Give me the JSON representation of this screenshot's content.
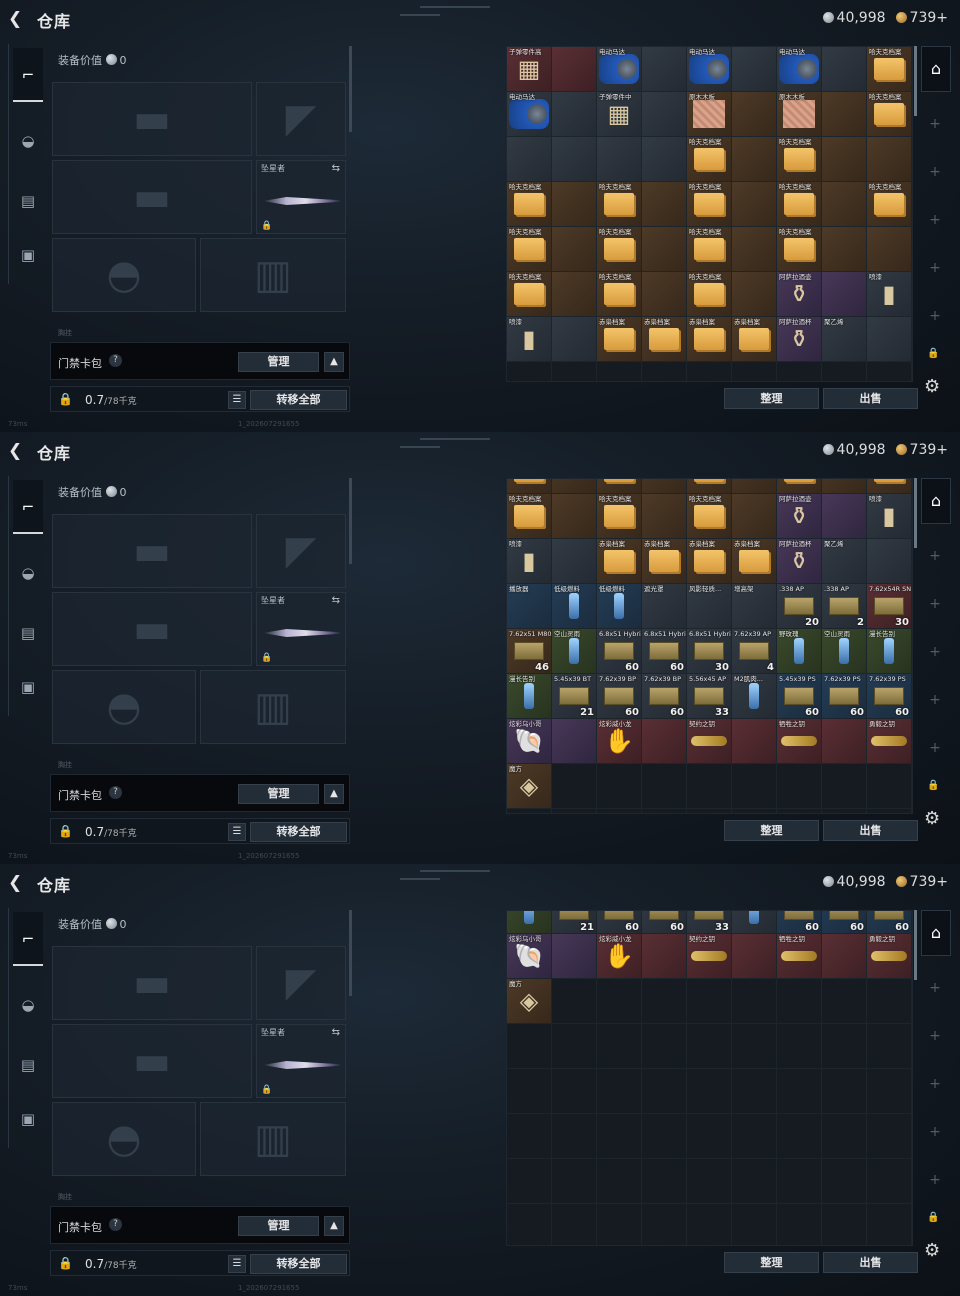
{
  "header": {
    "title": "仓库",
    "silver": "40,998",
    "gold": "739+"
  },
  "loadout": {
    "equip_value_label": "装备价值",
    "equip_value": "0",
    "melee_label": "坠星者",
    "faint_label": "胸挂",
    "access_card_label": "门禁卡包",
    "manage_label": "管理",
    "weight_value": "0.7",
    "weight_cap": "/78千克",
    "transfer_all_label": "转移全部"
  },
  "stash_buttons": {
    "sort_label": "整理",
    "sell_label": "出售"
  },
  "footer": {
    "ping": "73ms",
    "uid": "1_202607291655"
  },
  "colors": {
    "accent": "#d8d8d8",
    "rare_purple": "#483857",
    "rare_red": "#5a2f34",
    "gold_coin": "#d79b3d"
  },
  "nav_icons": [
    "gun-icon",
    "helmet-icon",
    "vest-icon",
    "briefcase-icon"
  ],
  "stash_views": [
    {
      "cells": [
        {
          "n": "子弹零件高",
          "r": "r-red",
          "p": "parts"
        },
        {
          "n": "",
          "r": "r-red",
          "p": "none"
        },
        {
          "n": "电动马达",
          "r": "r-gray",
          "p": "motor"
        },
        {
          "n": "",
          "r": "r-gray",
          "p": "none"
        },
        {
          "n": "电动马达",
          "r": "r-gray",
          "p": "motor"
        },
        {
          "n": "",
          "r": "r-gray",
          "p": "none"
        },
        {
          "n": "电动马达",
          "r": "r-gray",
          "p": "motor"
        },
        {
          "n": "",
          "r": "r-gray",
          "p": "none"
        },
        {
          "n": "哈夫克档案",
          "r": "r-brown",
          "p": "folder"
        },
        {
          "n": "电动马达",
          "r": "r-gray",
          "p": "motor"
        },
        {
          "n": "",
          "r": "r-gray",
          "p": "none"
        },
        {
          "n": "子弹零件中",
          "r": "r-gray",
          "p": "parts"
        },
        {
          "n": "",
          "r": "r-gray",
          "p": "none"
        },
        {
          "n": "原木木板",
          "r": "r-brown",
          "p": "wood"
        },
        {
          "n": "",
          "r": "r-brown",
          "p": "none"
        },
        {
          "n": "原木木板",
          "r": "r-brown",
          "p": "wood"
        },
        {
          "n": "",
          "r": "r-brown",
          "p": "none"
        },
        {
          "n": "哈夫克档案",
          "r": "r-brown",
          "p": "folder"
        },
        {
          "n": "",
          "r": "r-gray",
          "p": "none"
        },
        {
          "n": "",
          "r": "r-gray",
          "p": "none"
        },
        {
          "n": "",
          "r": "r-gray",
          "p": "none"
        },
        {
          "n": "",
          "r": "r-gray",
          "p": "none"
        },
        {
          "n": "哈夫克档案",
          "r": "r-brown",
          "p": "folder"
        },
        {
          "n": "",
          "r": "r-brown",
          "p": "none"
        },
        {
          "n": "哈夫克档案",
          "r": "r-brown",
          "p": "folder"
        },
        {
          "n": "",
          "r": "r-brown",
          "p": "none"
        },
        {
          "n": "",
          "r": "r-brown",
          "p": "none"
        },
        {
          "n": "哈夫克档案",
          "r": "r-brown",
          "p": "folder"
        },
        {
          "n": "",
          "r": "r-brown",
          "p": "none"
        },
        {
          "n": "哈夫克档案",
          "r": "r-brown",
          "p": "folder"
        },
        {
          "n": "",
          "r": "r-brown",
          "p": "none"
        },
        {
          "n": "哈夫克档案",
          "r": "r-brown",
          "p": "folder"
        },
        {
          "n": "",
          "r": "r-brown",
          "p": "none"
        },
        {
          "n": "哈夫克档案",
          "r": "r-brown",
          "p": "folder"
        },
        {
          "n": "",
          "r": "r-brown",
          "p": "none"
        },
        {
          "n": "哈夫克档案",
          "r": "r-brown",
          "p": "folder"
        },
        {
          "n": "哈夫克档案",
          "r": "r-brown",
          "p": "folder"
        },
        {
          "n": "",
          "r": "r-brown",
          "p": "none"
        },
        {
          "n": "哈夫克档案",
          "r": "r-brown",
          "p": "folder"
        },
        {
          "n": "",
          "r": "r-brown",
          "p": "none"
        },
        {
          "n": "哈夫克档案",
          "r": "r-brown",
          "p": "folder"
        },
        {
          "n": "",
          "r": "r-brown",
          "p": "none"
        },
        {
          "n": "哈夫克档案",
          "r": "r-brown",
          "p": "folder"
        },
        {
          "n": "",
          "r": "r-brown",
          "p": "none"
        },
        {
          "n": "",
          "r": "r-brown",
          "p": "none"
        },
        {
          "n": "哈夫克档案",
          "r": "r-brown",
          "p": "folder"
        },
        {
          "n": "",
          "r": "r-brown",
          "p": "none"
        },
        {
          "n": "哈夫克档案",
          "r": "r-brown",
          "p": "folder"
        },
        {
          "n": "",
          "r": "r-brown",
          "p": "none"
        },
        {
          "n": "哈夫克档案",
          "r": "r-brown",
          "p": "folder"
        },
        {
          "n": "",
          "r": "r-brown",
          "p": "none"
        },
        {
          "n": "阿萨拉酒壶",
          "r": "r-purple",
          "p": "jug"
        },
        {
          "n": "",
          "r": "r-purple",
          "p": "none"
        },
        {
          "n": "喷漆",
          "r": "r-gray",
          "p": "can"
        },
        {
          "n": "喷漆",
          "r": "r-gray",
          "p": "can"
        },
        {
          "n": "",
          "r": "r-gray",
          "p": "none"
        },
        {
          "n": "赤枭档案",
          "r": "r-brown",
          "p": "folder"
        },
        {
          "n": "赤枭档案",
          "r": "r-brown",
          "p": "folder"
        },
        {
          "n": "赤枭档案",
          "r": "r-brown",
          "p": "folder"
        },
        {
          "n": "赤枭档案",
          "r": "r-brown",
          "p": "folder"
        },
        {
          "n": "阿萨拉酒杯",
          "r": "r-purple",
          "p": "jug"
        },
        {
          "n": "聚乙烯",
          "r": "r-gray",
          "p": "none"
        },
        {
          "n": "",
          "r": "r-gray",
          "p": "none"
        }
      ]
    },
    {
      "cells": [
        {
          "n": "",
          "r": "r-brown",
          "p": "folder"
        },
        {
          "n": "",
          "r": "r-brown",
          "p": "none"
        },
        {
          "n": "",
          "r": "r-brown",
          "p": "folder"
        },
        {
          "n": "",
          "r": "r-brown",
          "p": "none"
        },
        {
          "n": "",
          "r": "r-brown",
          "p": "folder"
        },
        {
          "n": "",
          "r": "r-brown",
          "p": "none"
        },
        {
          "n": "",
          "r": "r-brown",
          "p": "folder"
        },
        {
          "n": "",
          "r": "r-brown",
          "p": "none"
        },
        {
          "n": "",
          "r": "r-brown",
          "p": "folder"
        },
        {
          "n": "哈夫克档案",
          "r": "r-brown",
          "p": "folder"
        },
        {
          "n": "",
          "r": "r-brown",
          "p": "none"
        },
        {
          "n": "哈夫克档案",
          "r": "r-brown",
          "p": "folder"
        },
        {
          "n": "",
          "r": "r-brown",
          "p": "none"
        },
        {
          "n": "哈夫克档案",
          "r": "r-brown",
          "p": "folder"
        },
        {
          "n": "",
          "r": "r-brown",
          "p": "none"
        },
        {
          "n": "阿萨拉酒壶",
          "r": "r-purple",
          "p": "jug"
        },
        {
          "n": "",
          "r": "r-purple",
          "p": "none"
        },
        {
          "n": "喷漆",
          "r": "r-gray",
          "p": "can"
        },
        {
          "n": "喷漆",
          "r": "r-gray",
          "p": "can"
        },
        {
          "n": "",
          "r": "r-gray",
          "p": "none"
        },
        {
          "n": "赤枭档案",
          "r": "r-brown",
          "p": "folder"
        },
        {
          "n": "赤枭档案",
          "r": "r-brown",
          "p": "folder"
        },
        {
          "n": "赤枭档案",
          "r": "r-brown",
          "p": "folder"
        },
        {
          "n": "赤枭档案",
          "r": "r-brown",
          "p": "folder"
        },
        {
          "n": "阿萨拉酒杯",
          "r": "r-purple",
          "p": "jug"
        },
        {
          "n": "聚乙烯",
          "r": "r-gray",
          "p": "none"
        },
        {
          "n": "",
          "r": "r-gray",
          "p": "none"
        },
        {
          "n": "播放器",
          "r": "r-blue",
          "p": "none"
        },
        {
          "n": "低级燃料",
          "r": "r-blue",
          "p": "vial"
        },
        {
          "n": "低级燃料",
          "r": "r-blue",
          "p": "vial"
        },
        {
          "n": "遮光罩",
          "r": "r-gray",
          "p": "none"
        },
        {
          "n": "风影轻质...",
          "r": "r-gray",
          "p": "none"
        },
        {
          "n": "增高架",
          "r": "r-gray",
          "p": "none"
        },
        {
          "n": ".338 AP",
          "r": "r-gray",
          "p": "ammo",
          "c": "20"
        },
        {
          "n": ".338 AP",
          "r": "r-gray",
          "p": "ammo",
          "c": "2"
        },
        {
          "n": "7.62x54R SNB",
          "r": "r-red",
          "p": "ammo",
          "c": "30"
        },
        {
          "n": "7.62x51 M80",
          "r": "r-brown",
          "p": "ammo",
          "c": "46"
        },
        {
          "n": "空山灵雨",
          "r": "r-green",
          "p": "vial"
        },
        {
          "n": "6.8x51 Hybrid",
          "r": "r-gray",
          "p": "ammo",
          "c": "60"
        },
        {
          "n": "6.8x51 Hybrid",
          "r": "r-gray",
          "p": "ammo",
          "c": "60"
        },
        {
          "n": "6.8x51 Hybrid",
          "r": "r-gray",
          "p": "ammo",
          "c": "30"
        },
        {
          "n": "7.62x39 AP",
          "r": "r-gray",
          "p": "ammo",
          "c": "4"
        },
        {
          "n": "野玫瑰",
          "r": "r-green",
          "p": "vial"
        },
        {
          "n": "空山灵雨",
          "r": "r-green",
          "p": "vial"
        },
        {
          "n": "漫长告别",
          "r": "r-green",
          "p": "vial"
        },
        {
          "n": "漫长告别",
          "r": "r-green",
          "p": "vial"
        },
        {
          "n": "5.45x39 BT",
          "r": "r-gray",
          "p": "ammo",
          "c": "21"
        },
        {
          "n": "7.62x39 BP",
          "r": "r-gray",
          "p": "ammo",
          "c": "60"
        },
        {
          "n": "7.62x39 BP",
          "r": "r-gray",
          "p": "ammo",
          "c": "60"
        },
        {
          "n": "5.56x45 AP",
          "r": "r-gray",
          "p": "ammo",
          "c": "33"
        },
        {
          "n": "M2肌肉...",
          "r": "r-gray",
          "p": "vial"
        },
        {
          "n": "5.45x39 PS",
          "r": "r-blue",
          "p": "ammo",
          "c": "60"
        },
        {
          "n": "7.62x39 PS",
          "r": "r-blue",
          "p": "ammo",
          "c": "60"
        },
        {
          "n": "7.62x39 PS",
          "r": "r-blue",
          "p": "ammo",
          "c": "60"
        },
        {
          "n": "炫彩乌小哥",
          "r": "r-purple",
          "p": "shell"
        },
        {
          "n": "",
          "r": "r-purple",
          "p": "none"
        },
        {
          "n": "炫彩威小龙",
          "r": "r-red",
          "p": "dragon"
        },
        {
          "n": "",
          "r": "r-red",
          "p": "none"
        },
        {
          "n": "契约之钥",
          "r": "r-red",
          "p": "key"
        },
        {
          "n": "",
          "r": "r-red",
          "p": "none"
        },
        {
          "n": "牺牲之钥",
          "r": "r-red",
          "p": "key"
        },
        {
          "n": "",
          "r": "r-red",
          "p": "none"
        },
        {
          "n": "勇毅之钥",
          "r": "r-red",
          "p": "key"
        },
        {
          "n": "魔方",
          "r": "r-brown",
          "p": "cube"
        },
        {
          "n": "",
          "r": "empty",
          "p": "none"
        }
      ]
    },
    {
      "cells": [
        {
          "n": "",
          "r": "r-green",
          "p": "vial"
        },
        {
          "n": "",
          "r": "r-gray",
          "p": "ammo",
          "c": "21"
        },
        {
          "n": "",
          "r": "r-gray",
          "p": "ammo",
          "c": "60"
        },
        {
          "n": "",
          "r": "r-gray",
          "p": "ammo",
          "c": "60"
        },
        {
          "n": "",
          "r": "r-gray",
          "p": "ammo",
          "c": "33"
        },
        {
          "n": "",
          "r": "r-gray",
          "p": "vial"
        },
        {
          "n": "",
          "r": "r-blue",
          "p": "ammo",
          "c": "60"
        },
        {
          "n": "",
          "r": "r-blue",
          "p": "ammo",
          "c": "60"
        },
        {
          "n": "",
          "r": "r-blue",
          "p": "ammo",
          "c": "60"
        },
        {
          "n": "炫彩乌小哥",
          "r": "r-purple",
          "p": "shell"
        },
        {
          "n": "",
          "r": "r-purple",
          "p": "none"
        },
        {
          "n": "炫彩威小龙",
          "r": "r-red",
          "p": "dragon"
        },
        {
          "n": "",
          "r": "r-red",
          "p": "none"
        },
        {
          "n": "契约之钥",
          "r": "r-red",
          "p": "key"
        },
        {
          "n": "",
          "r": "r-red",
          "p": "none"
        },
        {
          "n": "牺牲之钥",
          "r": "r-red",
          "p": "key"
        },
        {
          "n": "",
          "r": "r-red",
          "p": "none"
        },
        {
          "n": "勇毅之钥",
          "r": "r-red",
          "p": "key"
        },
        {
          "n": "魔方",
          "r": "r-brown",
          "p": "cube"
        }
      ]
    }
  ]
}
